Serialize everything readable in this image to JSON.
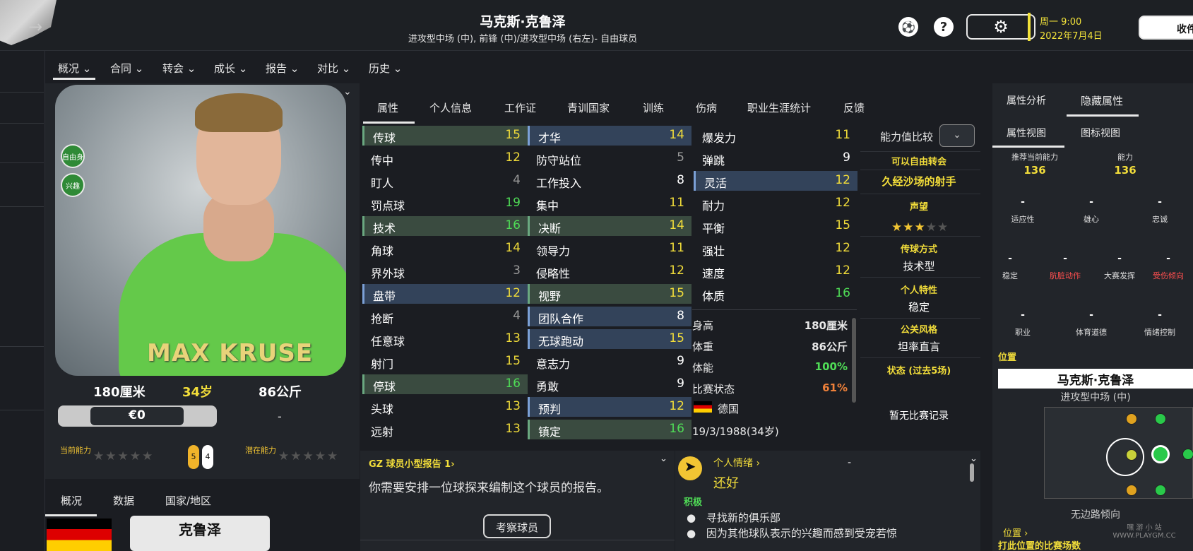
{
  "header": {
    "player_name": "马克斯·克鲁泽",
    "subtitle": "进攻型中场 (中), 前锋 (中)/进攻型中场 (右左)- 自由球员",
    "day_time": "周一 9:00",
    "date": "2022年7月4日",
    "inbox_label": "收件"
  },
  "nav": [
    "概况",
    "合同",
    "转会",
    "成长",
    "报告",
    "对比",
    "历史"
  ],
  "photo": {
    "shirt_name": "MAX KRUSE",
    "badge_free": "自由身",
    "badge_interest": "兴趣",
    "height": "180厘米",
    "age": "34岁",
    "weight": "86公斤",
    "value": "€0",
    "value_side": "-",
    "current_ability_label": "当前能力",
    "potential_ability_label": "潜在能力",
    "left_foot": "5",
    "right_foot": "4"
  },
  "bottom_tabs": [
    "概况",
    "数据",
    "国家/地区"
  ],
  "nickname": "克鲁泽",
  "attr_tabs": [
    "属性",
    "个人信息",
    "工作证",
    "青训国家",
    "训练",
    "伤病",
    "职业生涯统计",
    "反馈"
  ],
  "technical": [
    {
      "label": "传球",
      "value": "15"
    },
    {
      "label": "传中",
      "value": "12"
    },
    {
      "label": "盯人",
      "value": "4"
    },
    {
      "label": "罚点球",
      "value": "19"
    },
    {
      "label": "技术",
      "value": "16"
    },
    {
      "label": "角球",
      "value": "14"
    },
    {
      "label": "界外球",
      "value": "3"
    },
    {
      "label": "盘带",
      "value": "12"
    },
    {
      "label": "抢断",
      "value": "4"
    },
    {
      "label": "任意球",
      "value": "13"
    },
    {
      "label": "射门",
      "value": "15"
    },
    {
      "label": "停球",
      "value": "16"
    },
    {
      "label": "头球",
      "value": "13"
    },
    {
      "label": "远射",
      "value": "13"
    }
  ],
  "mental": [
    {
      "label": "才华",
      "value": "14"
    },
    {
      "label": "防守站位",
      "value": "5"
    },
    {
      "label": "工作投入",
      "value": "8"
    },
    {
      "label": "集中",
      "value": "11"
    },
    {
      "label": "决断",
      "value": "14"
    },
    {
      "label": "领导力",
      "value": "11"
    },
    {
      "label": "侵略性",
      "value": "12"
    },
    {
      "label": "视野",
      "value": "15"
    },
    {
      "label": "团队合作",
      "value": "8"
    },
    {
      "label": "无球跑动",
      "value": "15"
    },
    {
      "label": "意志力",
      "value": "9"
    },
    {
      "label": "勇敢",
      "value": "9"
    },
    {
      "label": "预判",
      "value": "12"
    },
    {
      "label": "镇定",
      "value": "16"
    }
  ],
  "physical": [
    {
      "label": "爆发力",
      "value": "11"
    },
    {
      "label": "弹跳",
      "value": "9"
    },
    {
      "label": "灵活",
      "value": "12"
    },
    {
      "label": "耐力",
      "value": "12"
    },
    {
      "label": "平衡",
      "value": "15"
    },
    {
      "label": "强壮",
      "value": "12"
    },
    {
      "label": "速度",
      "value": "12"
    },
    {
      "label": "体质",
      "value": "16"
    }
  ],
  "info": {
    "height_label": "身高",
    "height": "180厘米",
    "weight_label": "体重",
    "weight": "86公斤",
    "fitness_label": "体能",
    "fitness": "100%",
    "match_label": "比赛状态",
    "match": "61%",
    "nation": "德国",
    "dob": "19/3/1988(34岁)"
  },
  "compare": {
    "label": "能力值比较",
    "transfer": "可以自由转会",
    "title": "久经沙场的射手",
    "reputation_label": "声望",
    "stars": "★★★★★",
    "passing_label": "传球方式",
    "passing": "技术型",
    "personality_label": "个人特性",
    "personality": "稳定",
    "media_label": "公关风格",
    "media": "坦率直言",
    "form_label": "状态 (过去5场)",
    "form": "暂无比赛记录"
  },
  "report": {
    "title": "GZ 球员小型报告 1›",
    "text": "你需要安排一位球探来编制这个球员的报告。",
    "button": "考察球员"
  },
  "mood": {
    "title": "个人情绪 ›",
    "value": "还好",
    "dash": "-",
    "tag": "积极",
    "bullets": [
      "寻找新的俱乐部",
      "因为其他球队表示的兴趣而感到受宠若惊"
    ]
  },
  "right": {
    "tab1": "属性分析",
    "tab2": "隐藏属性",
    "sub1": "属性视图",
    "sub2": "图标视图",
    "recommended_label": "推荐当前能力",
    "recommended": "136",
    "ability_label": "能力",
    "ability": "136",
    "hidden": [
      {
        "label": "适应性",
        "value": "-"
      },
      {
        "label": "雄心",
        "value": "-"
      },
      {
        "label": "忠诚",
        "value": "-"
      },
      {
        "label": "稳定",
        "value": "-"
      },
      {
        "label": "肮脏动作",
        "value": "-"
      },
      {
        "label": "大赛发挥",
        "value": "-"
      },
      {
        "label": "受伤倾向",
        "value": "-"
      },
      {
        "label": "职业",
        "value": "-"
      },
      {
        "label": "体育道德",
        "value": "-"
      },
      {
        "label": "情绪控制",
        "value": "-"
      }
    ],
    "position_title": "位置",
    "position_name": "马克斯·克鲁泽",
    "position_role": "进攻型中场 (中)",
    "position_footer": "无边路倾向",
    "position_link": "位置 ›",
    "matches_label": "打此位置的比赛场数"
  },
  "watermark": "嘿 游 小 站  WWW.PLAYGM.CC",
  "colors": {
    "accent_yellow": "#f2dd3a",
    "good_green": "#4fdc56",
    "bg": "#1b1d22",
    "panel": "#22252a"
  }
}
